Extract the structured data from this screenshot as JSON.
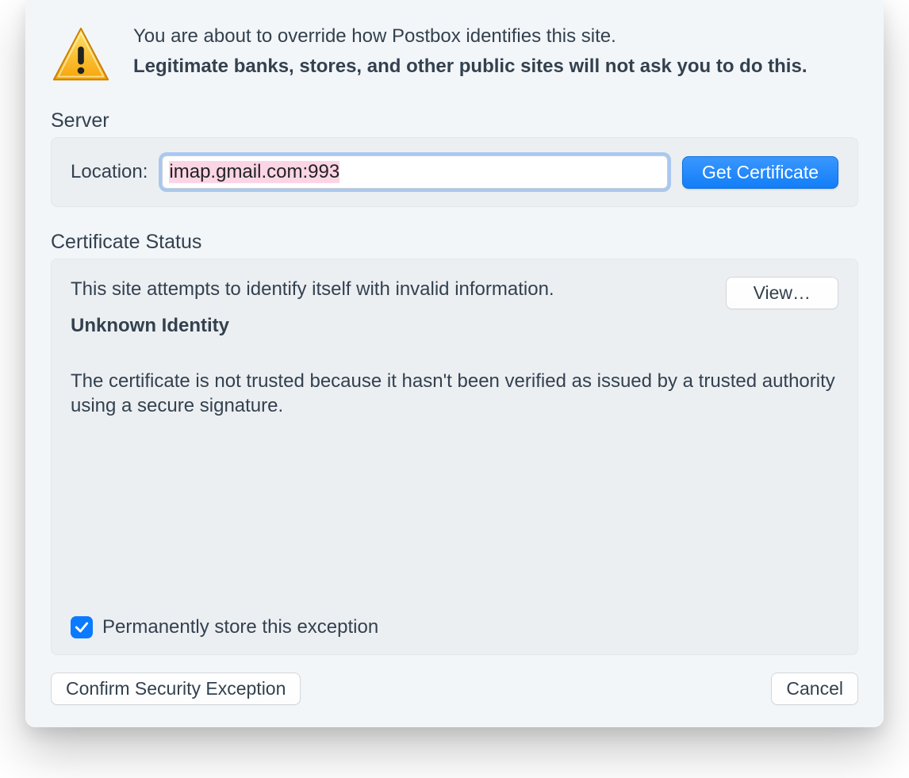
{
  "header": {
    "line1": "You are about to override how Postbox identifies this site.",
    "line2": "Legitimate banks, stores, and other public sites will not ask you to do this."
  },
  "server": {
    "section_label": "Server",
    "location_label": "Location:",
    "location_value": "imap.gmail.com:993",
    "get_cert_label": "Get Certificate"
  },
  "status": {
    "section_label": "Certificate Status",
    "message": "This site attempts to identify itself with invalid information.",
    "view_label": "View…",
    "subtitle": "Unknown Identity",
    "explanation": "The certificate is not trusted because it hasn't been verified as issued by a trusted authority using a secure signature.",
    "perm_store_label": "Permanently store this exception",
    "perm_store_checked": true
  },
  "footer": {
    "confirm_label": "Confirm Security Exception",
    "cancel_label": "Cancel"
  }
}
